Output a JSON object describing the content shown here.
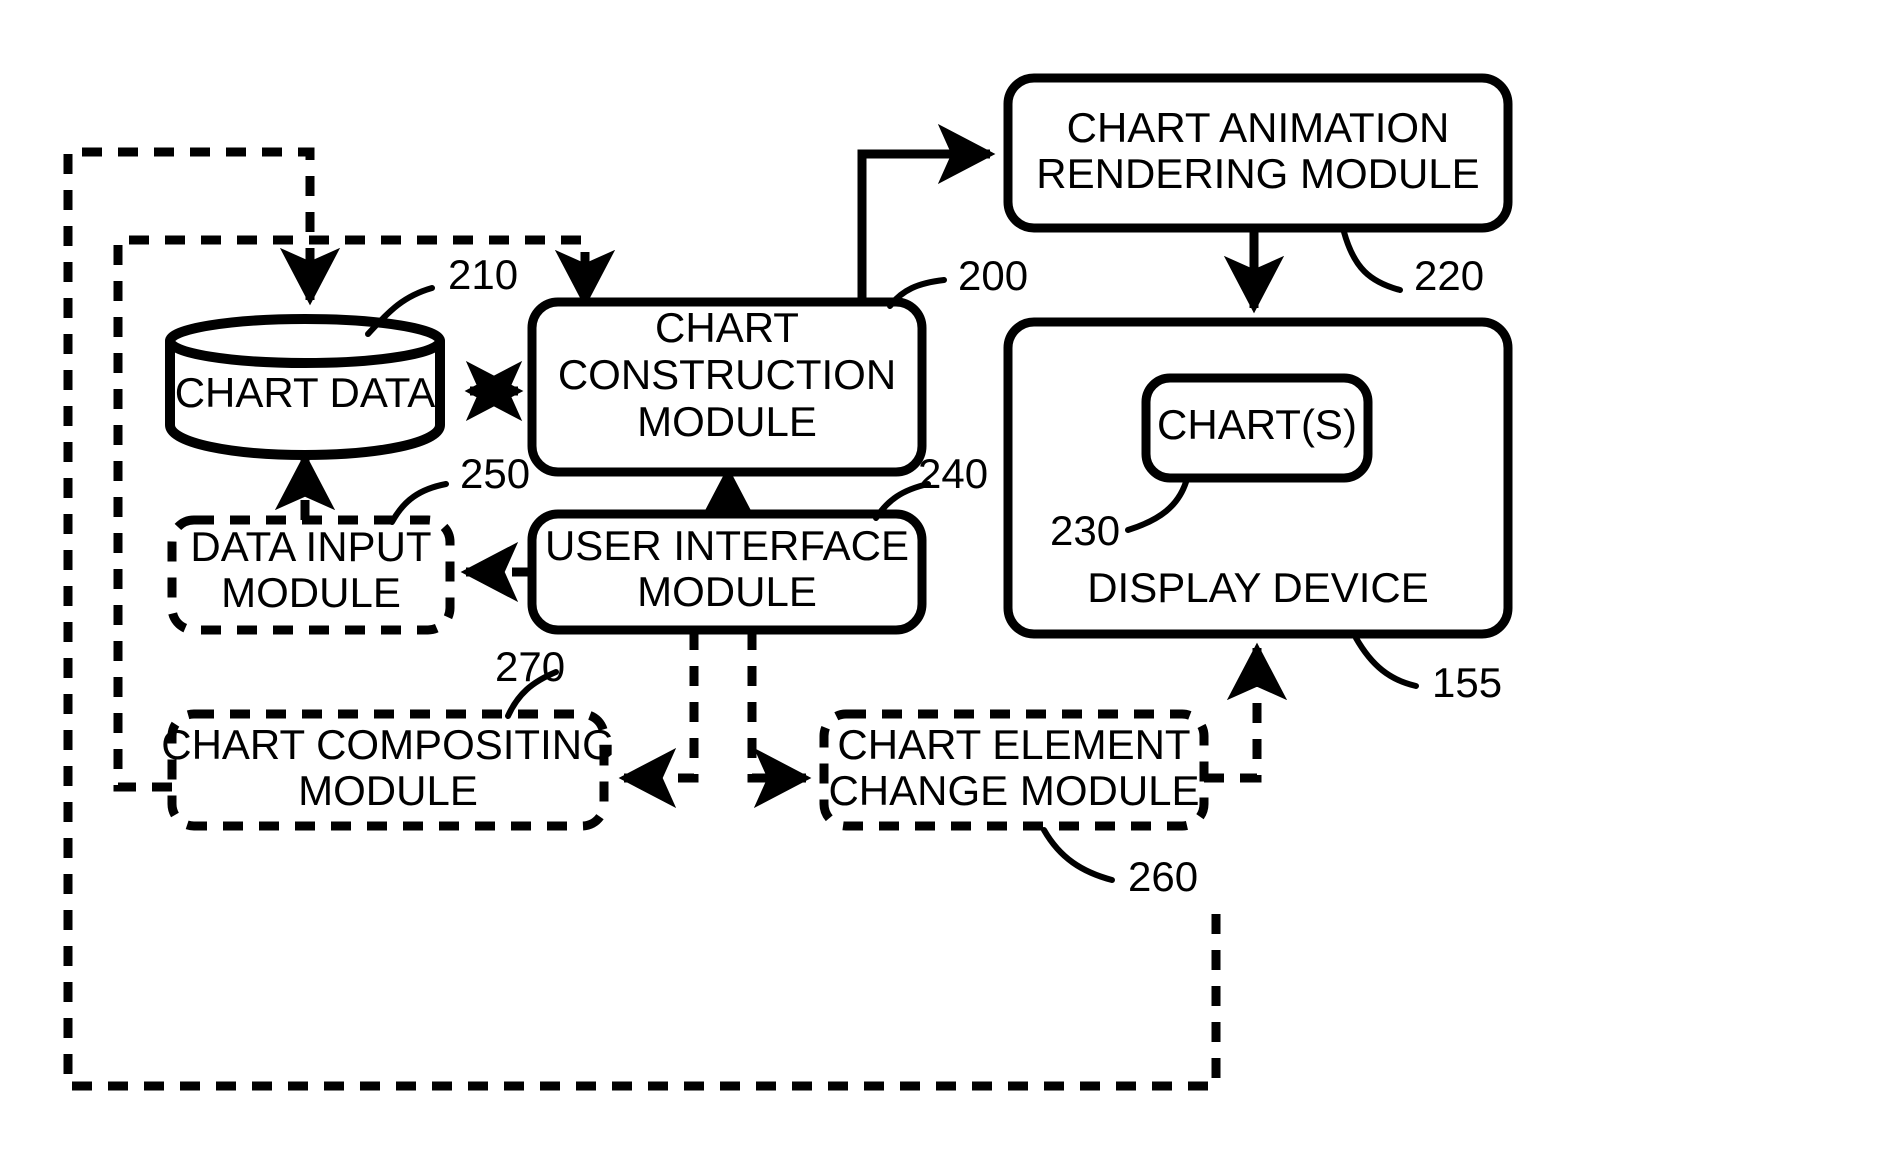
{
  "figure": {
    "title": "Chart construction system block diagram",
    "background_color": "#ffffff",
    "line_color": "#000000"
  },
  "nodes": {
    "chart_animation_rendering_module": {
      "label_line1": "CHART ANIMATION",
      "label_line2": "RENDERING MODULE",
      "ref": "220",
      "style": "solid"
    },
    "chart_data": {
      "label_line1": "CHART DATA",
      "ref": "210",
      "style": "cylinder"
    },
    "chart_construction_module": {
      "label_line1": "CHART",
      "label_line2": "CONSTRUCTION",
      "label_line3": "MODULE",
      "ref": "200",
      "style": "solid"
    },
    "display_device": {
      "label_line1": "DISPLAY DEVICE",
      "ref": "155",
      "style": "solid"
    },
    "charts": {
      "label_line1": "CHART(S)",
      "ref": "230",
      "style": "solid"
    },
    "data_input_module": {
      "label_line1": "DATA INPUT",
      "label_line2": "MODULE",
      "ref": "250",
      "style": "dashed"
    },
    "user_interface_module": {
      "label_line1": "USER INTERFACE",
      "label_line2": "MODULE",
      "ref": "240",
      "style": "solid"
    },
    "chart_compositing_module": {
      "label_line1": "CHART COMPOSITING",
      "label_line2": "MODULE",
      "ref": "270",
      "style": "dashed"
    },
    "chart_element_change_module": {
      "label_line1": "CHART ELEMENT",
      "label_line2": "CHANGE MODULE",
      "ref": "260",
      "style": "dashed"
    }
  },
  "reference_numerals": {
    "n200": "200",
    "n210": "210",
    "n220": "220",
    "n230": "230",
    "n240": "240",
    "n250": "250",
    "n260": "260",
    "n270": "270",
    "n155": "155"
  },
  "connections": [
    {
      "from": "chart_construction_module",
      "to": "chart_animation_rendering_module",
      "style": "solid",
      "arrow": "single"
    },
    {
      "from": "chart_animation_rendering_module",
      "to": "display_device",
      "style": "solid",
      "arrow": "single"
    },
    {
      "from": "chart_data",
      "to": "chart_construction_module",
      "style": "solid",
      "arrow": "double"
    },
    {
      "from": "user_interface_module",
      "to": "chart_construction_module",
      "style": "solid",
      "arrow": "single"
    },
    {
      "from": "user_interface_module",
      "to": "data_input_module",
      "style": "dashed",
      "arrow": "single"
    },
    {
      "from": "data_input_module",
      "to": "chart_data",
      "style": "dashed",
      "arrow": "single"
    },
    {
      "from": "user_interface_module",
      "to": "chart_compositing_module",
      "style": "dashed",
      "arrow": "single"
    },
    {
      "from": "user_interface_module",
      "to": "chart_element_change_module",
      "style": "dashed",
      "arrow": "single"
    },
    {
      "from": "chart_element_change_module",
      "to": "display_device",
      "style": "dashed",
      "arrow": "single"
    },
    {
      "from": "chart_compositing_module",
      "to": "chart_data",
      "style": "dashed",
      "arrow": "single"
    },
    {
      "from": "chart_element_change_module",
      "to": "chart_construction_module",
      "style": "dashed",
      "arrow": "single"
    }
  ]
}
